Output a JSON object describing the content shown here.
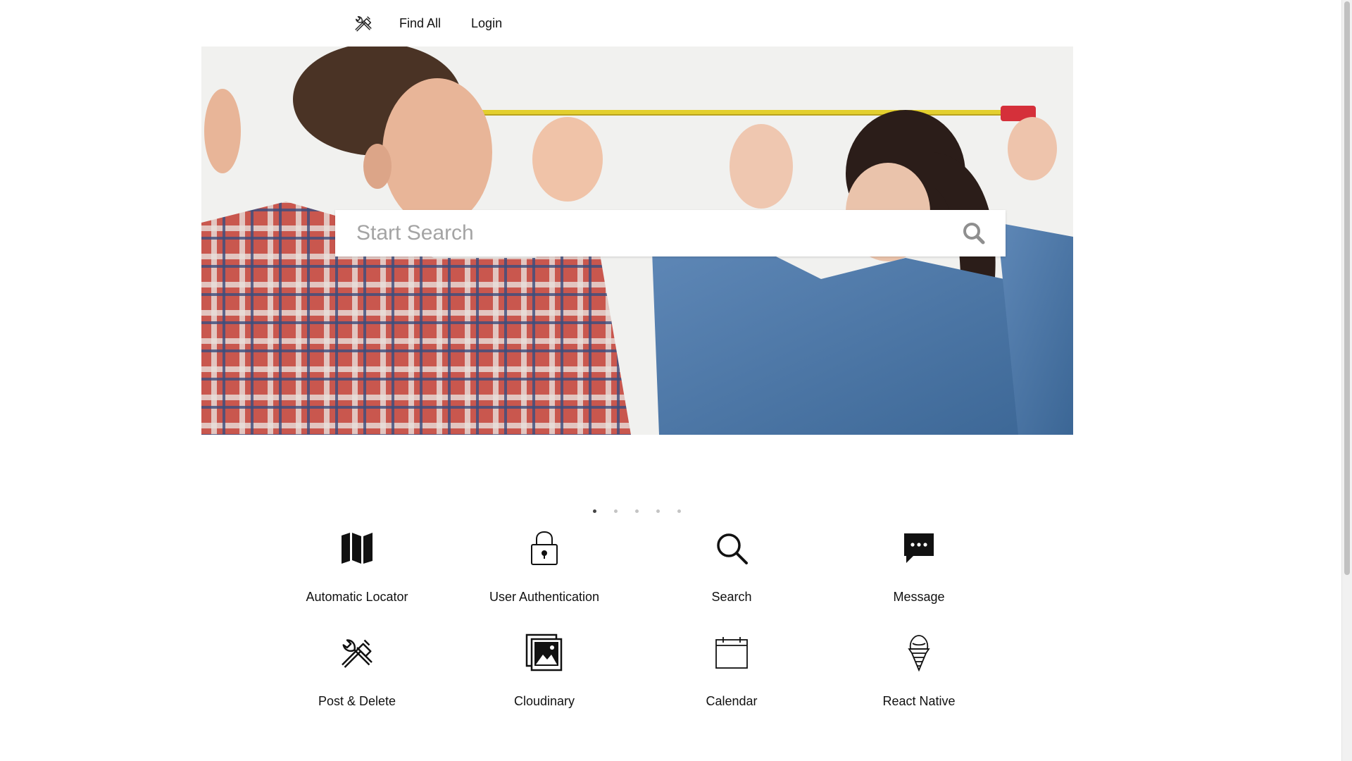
{
  "nav": {
    "logo_icon": "tools-icon",
    "find_all": "Find All",
    "login": "Login"
  },
  "hero": {
    "search_placeholder": "Start Search",
    "search_icon": "search-icon"
  },
  "carousel": {
    "total": 5,
    "active_index": 0
  },
  "features": [
    {
      "label": "Automatic Locator",
      "icon": "map-icon"
    },
    {
      "label": "User Authentication",
      "icon": "lock-icon"
    },
    {
      "label": "Search",
      "icon": "search-icon"
    },
    {
      "label": "Message",
      "icon": "message-icon"
    },
    {
      "label": "Post & Delete",
      "icon": "tools-icon"
    },
    {
      "label": "Cloudinary",
      "icon": "photos-icon"
    },
    {
      "label": "Calendar",
      "icon": "calendar-icon"
    },
    {
      "label": "React Native",
      "icon": "ice-cream-icon"
    }
  ]
}
